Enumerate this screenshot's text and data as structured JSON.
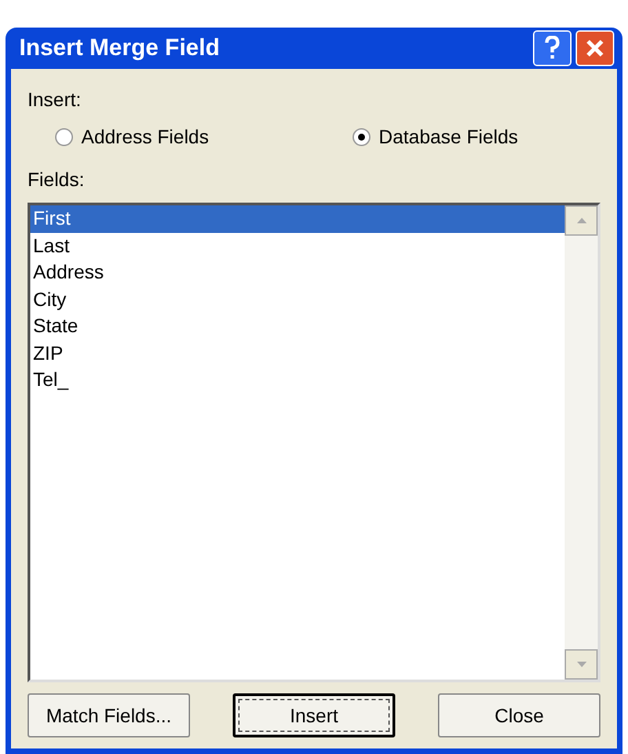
{
  "window": {
    "title": "Insert Merge Field"
  },
  "insert_group": {
    "label": "Insert:",
    "options": [
      {
        "label": "Address Fields",
        "selected": false
      },
      {
        "label": "Database Fields",
        "selected": true
      }
    ]
  },
  "fields": {
    "label": "Fields:",
    "items": [
      {
        "label": "First",
        "selected": true
      },
      {
        "label": "Last",
        "selected": false
      },
      {
        "label": "Address",
        "selected": false
      },
      {
        "label": "City",
        "selected": false
      },
      {
        "label": "State",
        "selected": false
      },
      {
        "label": "ZIP",
        "selected": false
      },
      {
        "label": "Tel_",
        "selected": false
      }
    ]
  },
  "buttons": [
    {
      "label": "Match Fields...",
      "default": false
    },
    {
      "label": "Insert",
      "default": true
    },
    {
      "label": "Close",
      "default": false
    }
  ]
}
